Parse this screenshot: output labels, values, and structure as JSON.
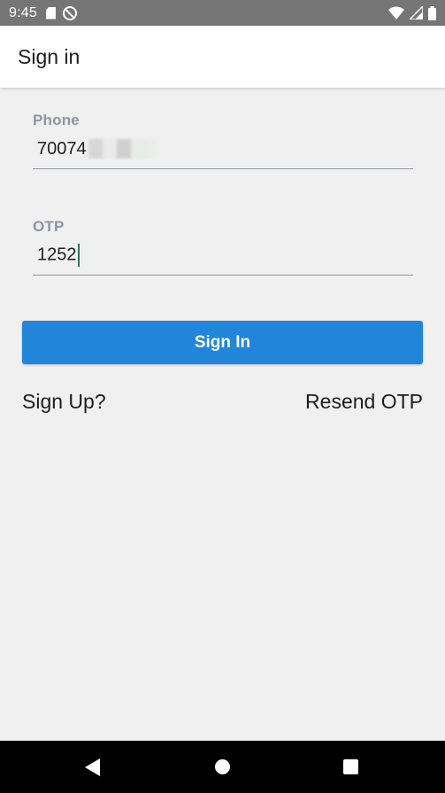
{
  "status_bar": {
    "time": "9:45",
    "left_icons": [
      "sd-card-icon",
      "data-saver-icon"
    ],
    "right_icons": [
      "wifi-icon",
      "signal-icon",
      "battery-icon"
    ]
  },
  "app_bar": {
    "title": "Sign in"
  },
  "form": {
    "phone": {
      "label": "Phone",
      "value_visible": "70074"
    },
    "otp": {
      "label": "OTP",
      "value": "1252"
    },
    "submit_label": "Sign In"
  },
  "links": {
    "sign_up": "Sign Up?",
    "resend_otp": "Resend OTP"
  },
  "nav_bar": {
    "buttons": [
      "back-icon",
      "home-icon",
      "recents-icon"
    ]
  },
  "colors": {
    "status_bar": "#757575",
    "app_bar": "#ffffff",
    "background": "#f0f0f0",
    "label": "#8a96a3",
    "primary_button": "#2185d9",
    "cursor": "#1e7a6a",
    "nav_bar": "#000000"
  }
}
